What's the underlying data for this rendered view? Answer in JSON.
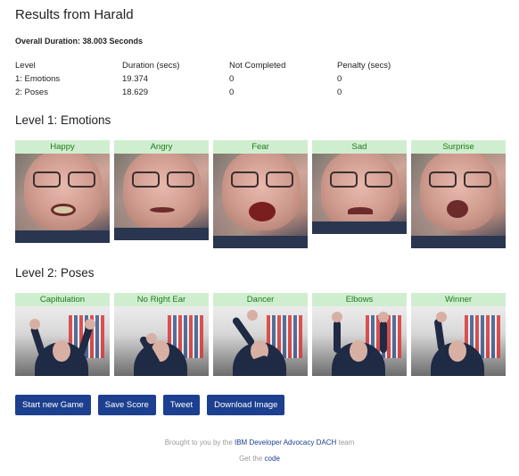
{
  "title": "Results from Harald",
  "overall": "Overall Duration: 38.003 Seconds",
  "stats": {
    "headers": [
      "Level",
      "Duration (secs)",
      "Not Completed",
      "Penalty (secs)"
    ],
    "rows": [
      [
        "1: Emotions",
        "19.374",
        "0",
        "0"
      ],
      [
        "2: Poses",
        "18.629",
        "0",
        "0"
      ]
    ]
  },
  "level1": {
    "title": "Level 1: Emotions",
    "items": [
      {
        "label": "Happy"
      },
      {
        "label": "Angry"
      },
      {
        "label": "Fear"
      },
      {
        "label": "Sad"
      },
      {
        "label": "Surprise"
      }
    ]
  },
  "level2": {
    "title": "Level 2: Poses",
    "items": [
      {
        "label": "Capitulation"
      },
      {
        "label": "No Right Ear"
      },
      {
        "label": "Dancer"
      },
      {
        "label": "Elbows"
      },
      {
        "label": "Winner"
      }
    ]
  },
  "buttons": {
    "new_game": "Start new Game",
    "save_score": "Save Score",
    "tweet": "Tweet",
    "download": "Download Image"
  },
  "footer": {
    "line1_prefix": "Brought to you by the ",
    "line1_link": "IBM Developer Advocacy DACH",
    "line1_suffix": " team",
    "line2_prefix": "Get the ",
    "line2_link": "code"
  },
  "colors": {
    "button": "#1c3f8f",
    "label_bg": "#cfeecf",
    "label_text": "#1f7a1f",
    "link": "#1c3f8f"
  }
}
